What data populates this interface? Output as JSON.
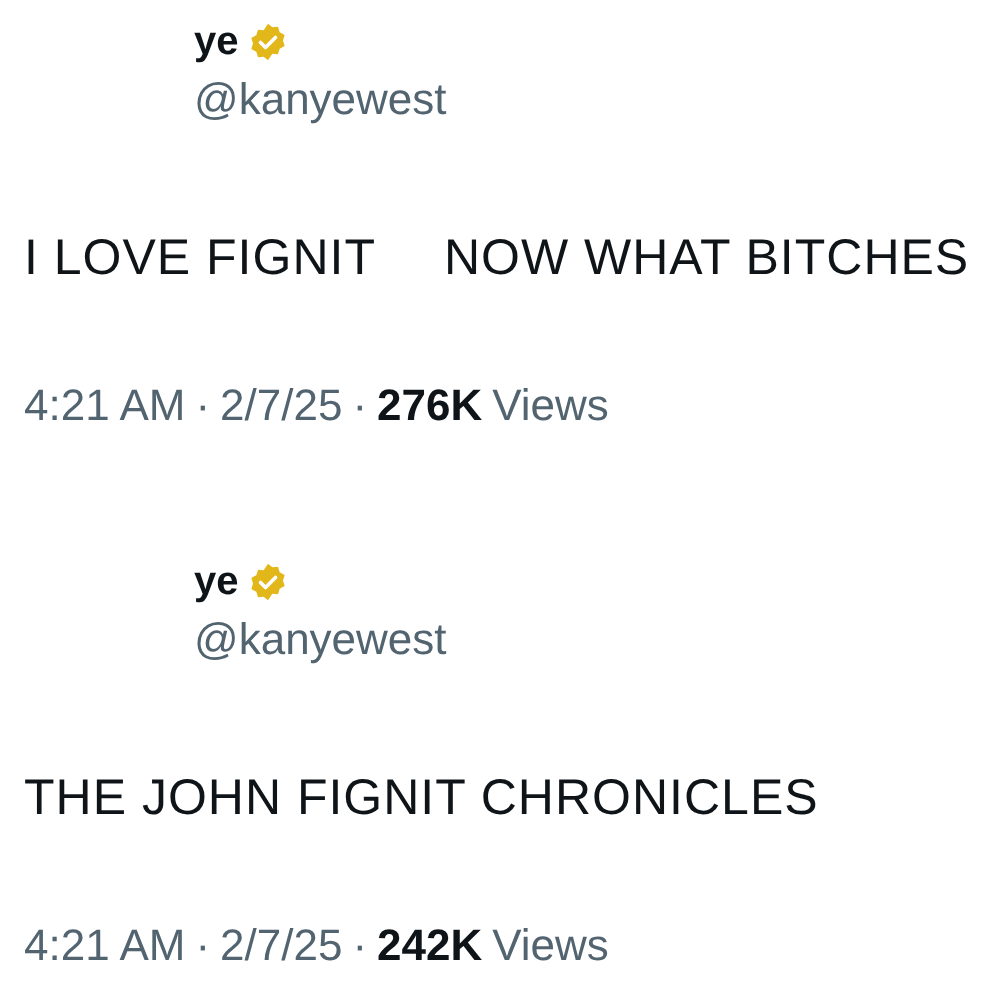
{
  "posts": [
    {
      "name": "ye",
      "verified": true,
      "handle": "@kanyewest",
      "text_parts": [
        "I LOVE FIGNIT",
        "NOW WHAT BITCHES"
      ],
      "time": "4:21 AM",
      "separator": "·",
      "date": "2/7/25",
      "views_count": "276K",
      "views_label": "Views"
    },
    {
      "name": "ye",
      "verified": true,
      "handle": "@kanyewest",
      "text_parts": [
        "THE JOHN FIGNIT CHRONICLES"
      ],
      "time": "4:21 AM",
      "separator": "·",
      "date": "2/7/25",
      "views_count": "242K",
      "views_label": "Views"
    }
  ]
}
